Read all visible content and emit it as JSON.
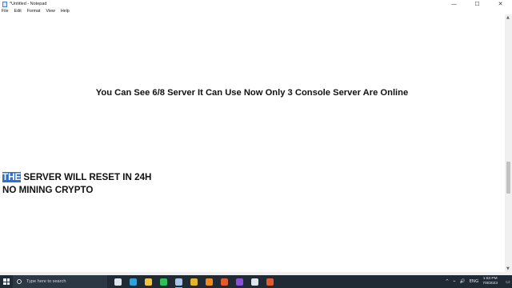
{
  "window": {
    "title": "*Untitled - Notepad",
    "controls": {
      "minimize": "—",
      "maximize": "☐",
      "close": "✕"
    }
  },
  "menu": {
    "items": [
      {
        "label": "File"
      },
      {
        "label": "Edit"
      },
      {
        "label": "Format"
      },
      {
        "label": "View"
      },
      {
        "label": "Help"
      }
    ]
  },
  "editor": {
    "line1": "You Can See 6/8 Server It Can Use Now Only 3 Console Server Are Online",
    "line2_selected": "THE",
    "line2_rest": " SERVER WILL RESET IN 24H",
    "line3": "NO MINING CRYPTO",
    "scroll_position": 0.66
  },
  "taskbar": {
    "search_placeholder": "Type here to search",
    "icons": [
      {
        "name": "task-view-icon",
        "color": "#dfe5ec"
      },
      {
        "name": "edge-icon",
        "color": "#2fa3d9"
      },
      {
        "name": "file-explorer-icon",
        "color": "#f2c440"
      },
      {
        "name": "whatsapp-icon",
        "color": "#2fbf5a"
      },
      {
        "name": "notepad-icon",
        "color": "#a9c6e8"
      },
      {
        "name": "chrome-icon",
        "color": "#e5b42a"
      },
      {
        "name": "vlc-icon",
        "color": "#f08a1c"
      },
      {
        "name": "brave-icon",
        "color": "#e35b2d"
      },
      {
        "name": "media-player-icon",
        "color": "#8a4fd8"
      },
      {
        "name": "screen-recorder-icon",
        "color": "#dfe5ec"
      },
      {
        "name": "brave-browser-icon",
        "color": "#e35b2d"
      }
    ],
    "tray_chevron": "^",
    "tray_glyphs": [
      "⌁",
      "🔊",
      "ENG"
    ],
    "time": "1:53 PM",
    "date": "7/8/2023"
  }
}
